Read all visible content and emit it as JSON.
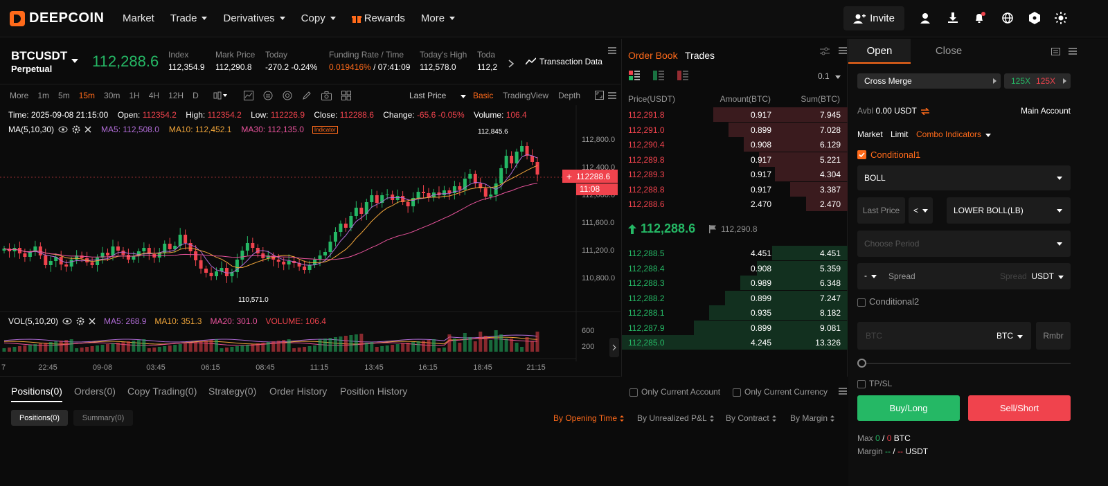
{
  "nav": {
    "logo": "DEEPCOIN",
    "items": [
      "Market",
      "Trade",
      "Derivatives",
      "Copy",
      "Rewards",
      "More"
    ],
    "invite": "Invite"
  },
  "symbol": {
    "name": "BTCUSDT",
    "type": "Perpetual",
    "price": "112,288.6",
    "stats": [
      {
        "label": "Index",
        "value": "112,354.9"
      },
      {
        "label": "Mark Price",
        "value": "112,290.8"
      },
      {
        "label": "Today",
        "value": "-270.2 -0.24%"
      },
      {
        "label": "Funding Rate / Time",
        "value": "0.019416%",
        "value2": " / 07:41:09"
      },
      {
        "label": "Today's High",
        "value": "112,578.0"
      },
      {
        "label": "Toda",
        "value": "112,2"
      }
    ],
    "transaction_data": "Transaction Data"
  },
  "chart_toolbar": {
    "intervals": [
      "More",
      "1m",
      "5m",
      "15m",
      "30m",
      "1H",
      "4H",
      "12H",
      "D"
    ],
    "active_interval": "15m",
    "last_price": "Last Price",
    "views": [
      "Basic",
      "TradingView",
      "Depth"
    ]
  },
  "chart_info": {
    "time_label": "Time:",
    "time": "2025-09-08 21:15:00",
    "open_label": "Open:",
    "open": "112354.2",
    "high_label": "High:",
    "high": "112354.2",
    "low_label": "Low:",
    "low": "112226.9",
    "close_label": "Close:",
    "close": "112288.6",
    "change_label": "Change:",
    "change": "-65.6 -0.05%",
    "volume_label": "Volume:",
    "volume": "106.4",
    "ma_title": "MA(5,10,30)",
    "ma5": "MA5: 112,508.0",
    "ma10": "MA10: 112,452.1",
    "ma30": "MA30: 112,135.0",
    "indicator_badge": "Indicator",
    "vol_title": "VOL(5,10,20)",
    "vol_ma5": "MA5: 268.9",
    "vol_ma10": "MA10: 351.3",
    "vol_ma20": "MA20: 301.0",
    "vol_volume": "VOLUME: 106.4",
    "peak_label": "112,845.6",
    "trough_label": "110,571.0",
    "price_tag": "112288.6",
    "countdown": "11:08"
  },
  "chart_data": {
    "type": "candlestick",
    "y_ticks": [
      "112,800.0",
      "112,400.0",
      "112,000.0",
      "111,600.0",
      "111,200.0",
      "110,800.0"
    ],
    "ylim": [
      110500,
      113000
    ],
    "x_ticks": [
      "7",
      "22:45",
      "09-08",
      "03:45",
      "06:15",
      "08:45",
      "11:15",
      "13:45",
      "16:15",
      "18:45",
      "21:15"
    ],
    "vol_ticks": [
      "600",
      "200"
    ],
    "closes": [
      111220,
      111180,
      111230,
      111150,
      111100,
      111170,
      111250,
      111120,
      110980,
      111040,
      111100,
      110990,
      110960,
      111060,
      111120,
      111080,
      111020,
      110980,
      111090,
      111160,
      111120,
      111250,
      111190,
      111130,
      111060,
      111110,
      111180,
      111230,
      111140,
      111090,
      111160,
      111290,
      111210,
      111260,
      111420,
      111300,
      111180,
      111050,
      110930,
      110870,
      110820,
      110890,
      110940,
      110820,
      110880,
      111060,
      111190,
      111300,
      111230,
      111150,
      111080,
      111120,
      111060,
      111030,
      110990,
      111040,
      111010,
      110960,
      110910,
      110980,
      111060,
      111120,
      111170,
      111320,
      111460,
      111580,
      111520,
      111690,
      111810,
      111720,
      111890,
      111990,
      111880,
      111990,
      112000,
      111920,
      111980,
      111890,
      111830,
      111950,
      112040,
      112020,
      111960,
      112030,
      111990,
      112060,
      112020,
      112120,
      112070,
      112230,
      112300,
      112160,
      112090,
      111970,
      112000,
      112160,
      112380,
      112560,
      112450,
      112620,
      112700,
      112560,
      112470,
      112288
    ]
  },
  "orderbook": {
    "tabs": [
      "Order Book",
      "Trades"
    ],
    "precision": "0.1",
    "headers": [
      "Price(USDT)",
      "Amount(BTC)",
      "Sum(BTC)"
    ],
    "asks": [
      {
        "p": "112,291.8",
        "a": "0.917",
        "s": "7.945"
      },
      {
        "p": "112,291.0",
        "a": "0.899",
        "s": "7.028"
      },
      {
        "p": "112,290.4",
        "a": "0.908",
        "s": "6.129"
      },
      {
        "p": "112,289.8",
        "a": "0.917",
        "s": "5.221"
      },
      {
        "p": "112,289.3",
        "a": "0.917",
        "s": "4.304"
      },
      {
        "p": "112,288.8",
        "a": "0.917",
        "s": "3.387"
      },
      {
        "p": "112,288.6",
        "a": "2.470",
        "s": "2.470"
      }
    ],
    "mid_price": "112,288.6",
    "mark_price": "112,290.8",
    "bids": [
      {
        "p": "112,288.5",
        "a": "4.451",
        "s": "4.451"
      },
      {
        "p": "112,288.4",
        "a": "0.908",
        "s": "5.359"
      },
      {
        "p": "112,288.3",
        "a": "0.989",
        "s": "6.348"
      },
      {
        "p": "112,288.2",
        "a": "0.899",
        "s": "7.247"
      },
      {
        "p": "112,288.1",
        "a": "0.935",
        "s": "8.182"
      },
      {
        "p": "112,287.9",
        "a": "0.899",
        "s": "9.081"
      },
      {
        "p": "112,285.0",
        "a": "4.245",
        "s": "13.326"
      }
    ]
  },
  "trade": {
    "tabs": [
      "Open",
      "Close"
    ],
    "margin_mode": "Cross Merge",
    "lev_long": "125X",
    "lev_short": "125X",
    "avbl_label": "Avbl",
    "avbl": "0.00 USDT",
    "main_account": "Main Account",
    "order_types": [
      "Market",
      "Limit",
      "Combo Indicators"
    ],
    "cond1": "Conditional1",
    "indicator": "BOLL",
    "last_price": "Last Price",
    "op": "<",
    "boll_line": "LOWER BOLL(LB)",
    "choose_period": "Choose Period",
    "dash": "-",
    "spread_label": "Spread",
    "spread_placeholder": "Spread",
    "usdt": "USDT",
    "cond2": "Conditional2",
    "btc_placeholder": "BTC",
    "btc_unit": "BTC",
    "rmbr": "Rmbr",
    "tpsl": "TP/SL",
    "buy": "Buy/Long",
    "sell": "Sell/Short",
    "max_label": "Max",
    "max_buy": "0",
    "max_sell": "0",
    "max_unit": "BTC",
    "margin_label": "Margin",
    "margin_buy": "--",
    "margin_sell": "--",
    "margin_unit": "USDT"
  },
  "bottom": {
    "tabs": [
      "Positions(0)",
      "Orders(0)",
      "Copy Trading(0)",
      "Strategy(0)",
      "Order History",
      "Position History"
    ],
    "only_current_account": "Only Current Account",
    "only_current_currency": "Only Current Currency",
    "subtabs": [
      "Positions(0)",
      "Summary(0)"
    ],
    "sorts": [
      "By Opening Time",
      "By Unrealized P&L",
      "By Contract",
      "By Margin"
    ]
  },
  "colors": {
    "accent": "#ff6a1a",
    "up": "#25b865",
    "down": "#f0434d",
    "bg": "#0b0b0b"
  }
}
